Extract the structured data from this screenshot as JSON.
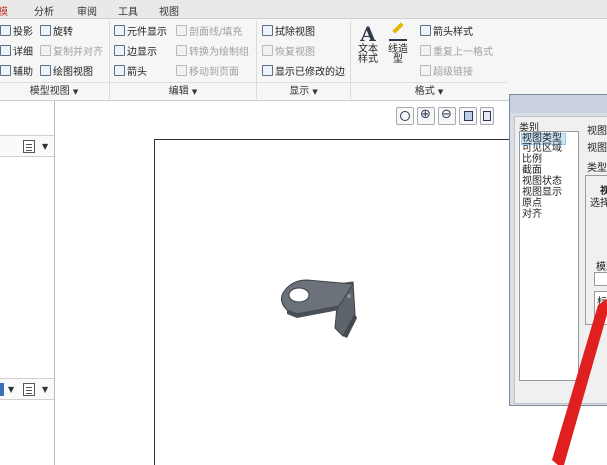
{
  "tabs": [
    {
      "label": "模"
    },
    {
      "label": "分析"
    },
    {
      "label": "审阅"
    },
    {
      "label": "工具"
    },
    {
      "label": "视图"
    }
  ],
  "ribbon": {
    "model_view": {
      "items": [
        "投影",
        "旋转",
        "详细",
        "复制并对齐",
        "辅助",
        "绘图视图"
      ],
      "footer": "模型视图"
    },
    "edit": {
      "items": [
        "元件显示",
        "剖面线/填充",
        "边显示",
        "转换为绘制组",
        "箭头",
        "移动到页面"
      ],
      "footer": "编辑"
    },
    "display": {
      "items": [
        "拭除视图",
        "恢复视图",
        "显示已修改的边"
      ],
      "footer": "显示"
    },
    "format": {
      "text_style": [
        "文本",
        "样式"
      ],
      "line_style": [
        "线造",
        "型"
      ],
      "items": [
        "箭头样式",
        "重复上一格式",
        "超级链接"
      ],
      "footer": "格式"
    }
  },
  "dialog": {
    "category_label": "类别",
    "categories": [
      "视图类型",
      "可见区域",
      "比例",
      "截面",
      "视图状态",
      "视图显示",
      "原点",
      "对齐"
    ],
    "selected_category": 0,
    "right": {
      "heading": "视图类",
      "name_label": "视图名",
      "type_label": "类型",
      "section_label": "视",
      "select_label": "选择",
      "model_label": "模型",
      "list_text": [
        "标",
        "默",
        "1"
      ]
    }
  },
  "colors": {
    "tab_active_text": "#c0392b",
    "selection": "#cce4f7",
    "arrow": "#e02020"
  },
  "icons": [
    "projection-icon",
    "rotate-icon",
    "detail-icon",
    "copy-align-icon",
    "auxiliary-icon",
    "drawing-view-icon",
    "component-display-icon",
    "hatch-icon",
    "edge-display-icon",
    "convert-group-icon",
    "arrow-icon",
    "move-page-icon",
    "erase-view-icon",
    "restore-view-icon",
    "modified-edges-icon",
    "text-style-icon",
    "line-style-icon",
    "arrow-style-icon",
    "repeat-format-icon",
    "hyperlink-icon",
    "refit-icon",
    "zoom-in-icon",
    "zoom-out-icon",
    "repaint-icon",
    "display-style-icon"
  ]
}
